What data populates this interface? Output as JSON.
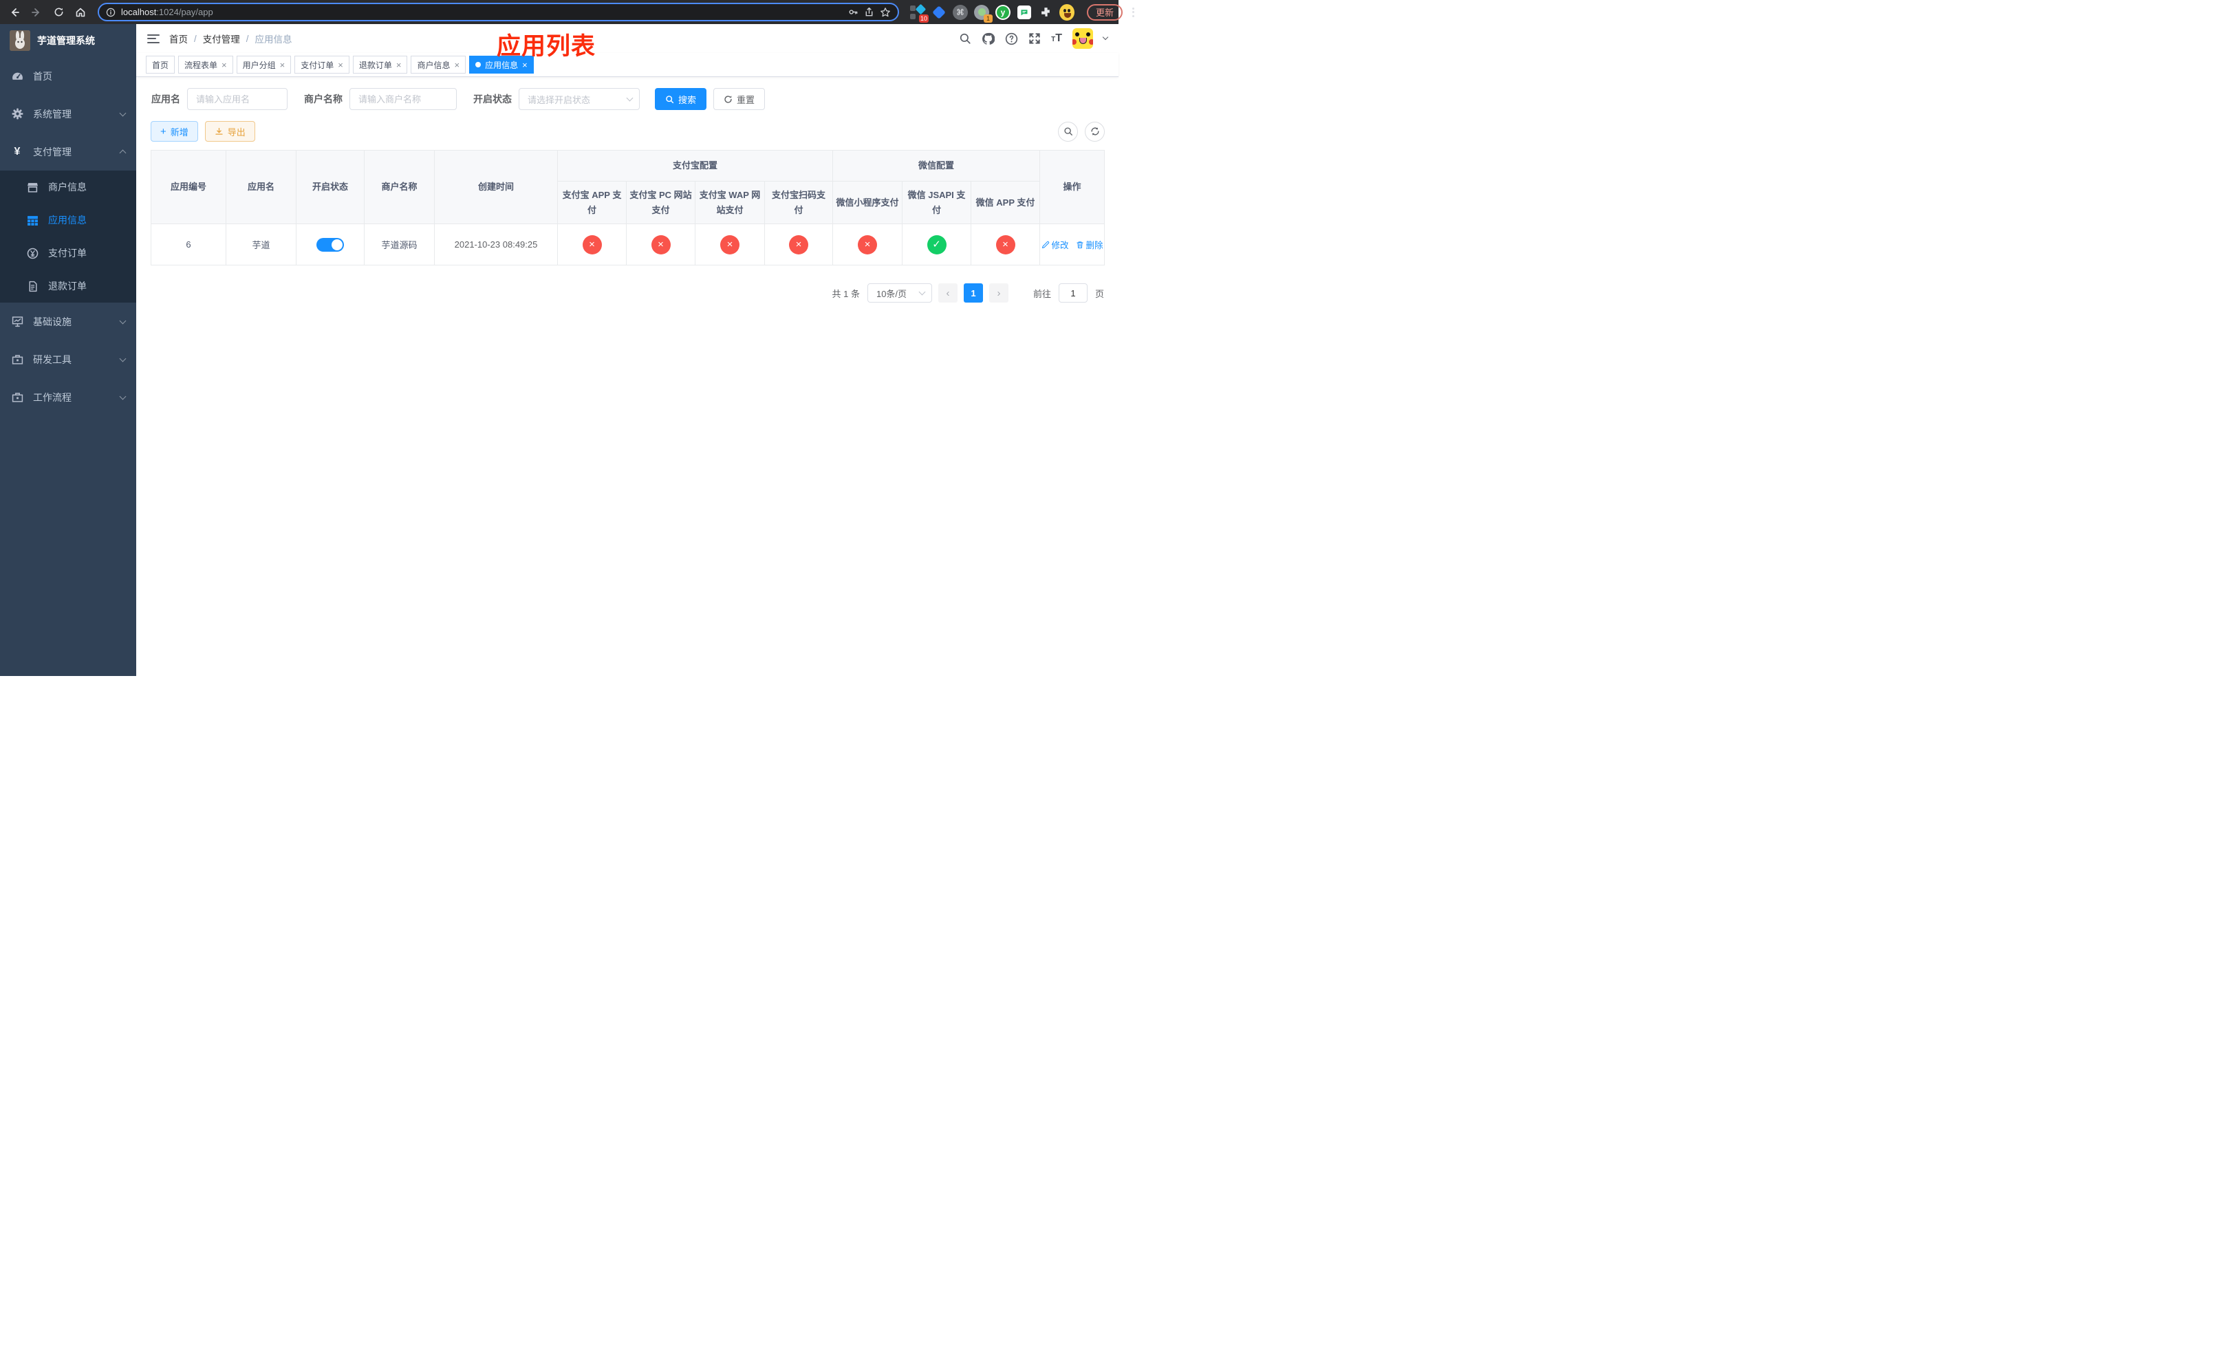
{
  "browser": {
    "url": {
      "host": "localhost",
      "path": ":1024/pay/app"
    },
    "update_button": "更新",
    "badges": {
      "extension_pin": "10",
      "extension_record": "1"
    }
  },
  "sidebar": {
    "logo_title": "芋道管理系统",
    "items": [
      {
        "label": "首页"
      },
      {
        "label": "系统管理"
      },
      {
        "label": "支付管理"
      },
      {
        "label": "商户信息"
      },
      {
        "label": "应用信息"
      },
      {
        "label": "支付订单"
      },
      {
        "label": "退款订单"
      },
      {
        "label": "基础设施"
      },
      {
        "label": "研发工具"
      },
      {
        "label": "工作流程"
      }
    ]
  },
  "header": {
    "breadcrumb": [
      "首页",
      "支付管理",
      "应用信息"
    ]
  },
  "annotation": {
    "text": "应用列表"
  },
  "tabs": [
    {
      "label": "首页"
    },
    {
      "label": "流程表单"
    },
    {
      "label": "用户分组"
    },
    {
      "label": "支付订单"
    },
    {
      "label": "退款订单"
    },
    {
      "label": "商户信息"
    },
    {
      "label": "应用信息"
    }
  ],
  "filters": {
    "app_name_label": "应用名",
    "app_name_placeholder": "请输入应用名",
    "merchant_label": "商户名称",
    "merchant_placeholder": "请输入商户名称",
    "status_label": "开启状态",
    "status_placeholder": "请选择开启状态",
    "search_button": "搜索",
    "reset_button": "重置"
  },
  "toolbar": {
    "add_button": "新增",
    "export_button": "导出"
  },
  "table": {
    "columns": {
      "app_id": "应用编号",
      "app_name": "应用名",
      "status": "开启状态",
      "merchant": "商户名称",
      "created": "创建时间",
      "alipay_group": "支付宝配置",
      "wechat_group": "微信配置",
      "alipay_app": "支付宝 APP 支付",
      "alipay_pc": "支付宝 PC 网站支付",
      "alipay_wap": "支付宝 WAP 网站支付",
      "alipay_qr": "支付宝扫码支付",
      "wx_lite": "微信小程序支付",
      "wx_jsapi": "微信 JSAPI 支付",
      "wx_app": "微信 APP 支付",
      "actions": "操作"
    },
    "row": {
      "app_id": "6",
      "app_name": "芋道",
      "enabled": true,
      "merchant": "芋道源码",
      "created": "2021-10-23 08:49:25",
      "alipay_app": false,
      "alipay_pc": false,
      "alipay_wap": false,
      "alipay_qr": false,
      "wx_lite": false,
      "wx_jsapi": true,
      "wx_app": false,
      "edit_label": "修改",
      "delete_label": "删除"
    }
  },
  "pagination": {
    "total": "共 1 条",
    "page_size": "10条/页",
    "current_page": "1",
    "goto_label": "前往",
    "goto_value": "1",
    "goto_suffix": "页"
  },
  "colors": {
    "accent": "#1890ff",
    "success": "#13ce66",
    "danger": "#f9544b",
    "annotation": "#fb2c0c"
  }
}
